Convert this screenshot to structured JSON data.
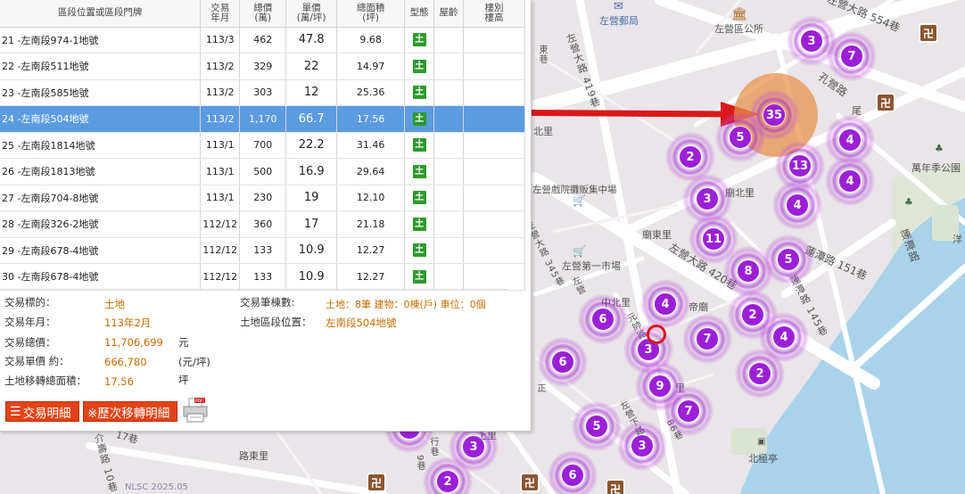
{
  "table": {
    "headers": {
      "address": "區段位置或區段門牌",
      "date": [
        "交易",
        "年月"
      ],
      "total": [
        "總價",
        "(萬)"
      ],
      "unit": [
        "單價",
        "(萬/坪)"
      ],
      "area": [
        "總面積",
        "(坪)"
      ],
      "type": "型態",
      "age": "屋齡",
      "floor": [
        "樓別",
        "樓高"
      ]
    },
    "rows": [
      {
        "addr": "21 -左南段974-1地號",
        "date": "113/3",
        "total": "462",
        "unit": "47.8",
        "area": "9.68",
        "type": "土"
      },
      {
        "addr": "22 -左南段511地號",
        "date": "113/2",
        "total": "329",
        "unit": "22",
        "area": "14.97",
        "type": "土"
      },
      {
        "addr": "23 -左南段585地號",
        "date": "113/2",
        "total": "303",
        "unit": "12",
        "area": "25.36",
        "type": "土"
      },
      {
        "addr": "24 -左南段504地號",
        "date": "113/2",
        "total": "1,170",
        "unit": "66.7",
        "area": "17.56",
        "type": "土"
      },
      {
        "addr": "25 -左南段1814地號",
        "date": "113/1",
        "total": "700",
        "unit": "22.2",
        "area": "31.46",
        "type": "土"
      },
      {
        "addr": "26 -左南段1813地號",
        "date": "113/1",
        "total": "500",
        "unit": "16.9",
        "area": "29.64",
        "type": "土"
      },
      {
        "addr": "27 -左南段704-8地號",
        "date": "113/1",
        "total": "230",
        "unit": "19",
        "area": "12.10",
        "type": "土"
      },
      {
        "addr": "28 -左南段326-2地號",
        "date": "112/12",
        "total": "360",
        "unit": "17",
        "area": "21.18",
        "type": "土"
      },
      {
        "addr": "29 -左南段678-4地號",
        "date": "112/12",
        "total": "133",
        "unit": "10.9",
        "area": "12.27",
        "type": "土"
      },
      {
        "addr": "30 -左南段678-4地號",
        "date": "112/12",
        "total": "133",
        "unit": "10.9",
        "area": "12.27",
        "type": "土"
      }
    ]
  },
  "details": {
    "target_label": "交易標的：",
    "target_value": "土地",
    "ym_label": "交易年月：",
    "ym_value": "113年2月",
    "total_label": "交易總價：",
    "total_value": "11,706,699",
    "total_unit": "元",
    "unitprice_label": "交易單價 約：",
    "unitprice_value": "666,780",
    "unitprice_unit": "(元/坪)",
    "area_label": "土地移轉總面積：",
    "area_value": "17.56",
    "area_unit": "坪",
    "count_label": "交易筆棟數:",
    "count_value": "土地：8筆 建物：0棟(戶) 車位：0個",
    "land_loc_label": "土地區段位置：",
    "land_loc_value": "左南段504地號"
  },
  "buttons": {
    "detail": "交易明細",
    "history": "※歷次移轉明細"
  },
  "map": {
    "labels": {
      "post_office": "左營郵局",
      "district_office": "左營區公所",
      "beili": "北里",
      "art_center": "左營戲院攤販集中場",
      "miaobei": "廟北里",
      "miaodong": "廟東里",
      "market": "左營第一市場",
      "zhongbei": "中北里",
      "temple": "帝廟",
      "li": "里",
      "wannian_park": "萬年季公園",
      "luzhong": "路東里",
      "beiji": "北極亭",
      "yang": "洋",
      "nlsc": "NLSC 2025.05",
      "zheng": "正",
      "road_zuoying_554": "左營大路 554巷",
      "road_419": "左營大路 419巷",
      "road_420": "左營大路 420巷",
      "road_lianchi_151": "蓮潭路 151巷",
      "road_lianchi_145": "蓮潭路 145巷",
      "road_lianchi": "蓮潭路",
      "road_kongying": "孔營路",
      "road_zuoying": "左營大路",
      "road_dong": "東巷",
      "road_chaoyang": "左營大路 345巷",
      "road_yuanxi": "元帥路",
      "road_86": "86巷",
      "road_jieyu_10": "介壽路 10巷",
      "road_17": "17巷",
      "road_zuoying_partial": "左營",
      "road_hang": "行巷",
      "road_qiaozi": "左營下路",
      "road_9": "9巷",
      "ruyi_li": "尾",
      "shang_li": "上里"
    },
    "clusters": [
      {
        "n": "3"
      },
      {
        "n": "7"
      },
      {
        "n": "35"
      },
      {
        "n": "5"
      },
      {
        "n": "2"
      },
      {
        "n": "4"
      },
      {
        "n": "13"
      },
      {
        "n": "4"
      },
      {
        "n": "3"
      },
      {
        "n": "4"
      },
      {
        "n": "11"
      },
      {
        "n": "5"
      },
      {
        "n": "8"
      },
      {
        "n": "4"
      },
      {
        "n": "6"
      },
      {
        "n": "2"
      },
      {
        "n": "7"
      },
      {
        "n": "4"
      },
      {
        "n": "3"
      },
      {
        "n": "6"
      },
      {
        "n": "2"
      },
      {
        "n": "9"
      },
      {
        "n": "7"
      },
      {
        "n": "5"
      },
      {
        "n": "3"
      },
      {
        "n": "3"
      },
      {
        "n": "6"
      },
      {
        "n": "2"
      },
      {
        "n": "2"
      }
    ],
    "temple_glyph": "卍",
    "colors": {
      "cluster": "#9c1fd6",
      "highlight": "#e89048",
      "water": "#a8d3ea",
      "arrow": "#d8191c",
      "selected_row": "#5b9be0",
      "land_badge": "#2c9a2c"
    }
  }
}
